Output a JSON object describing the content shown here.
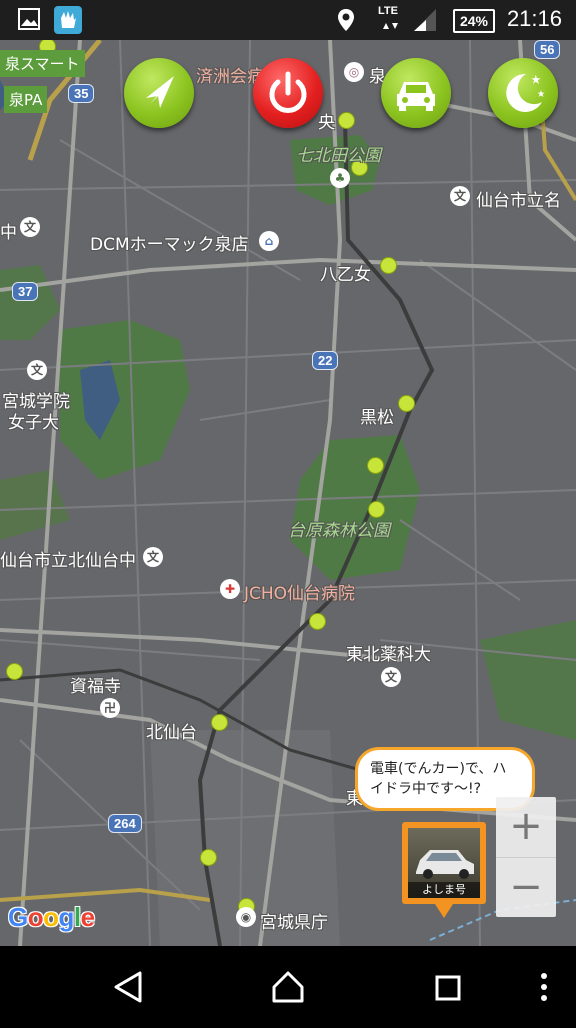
{
  "status_bar": {
    "time": "21:16",
    "battery": "24%",
    "network": "LTE",
    "icons": [
      "image-icon",
      "glove-app-icon",
      "location-pin-icon",
      "signal-icon"
    ]
  },
  "map_labels": {
    "izumi_smart": "泉スマート",
    "izumi_pa": "泉PA",
    "hospital_top": "済洲会病院",
    "izumi_top": "泉",
    "chuo": "央",
    "nanakita_park": "七北田公園",
    "sendai_school_top": "仙台市立名",
    "naka": "中",
    "dcm": "DCMホーマック泉店",
    "yaotome": "八乙女",
    "miyagi_gakuin": "宮城学院",
    "joshidai": "女子大",
    "kuromatsu": "黒松",
    "dainohara_park": "台原森林公園",
    "kitasendai_school": "仙台市立北仙台中",
    "jcho_hospital": "JCHO仙台病院",
    "tohoku_yakka": "東北薬科大",
    "shifukuji": "資福寺",
    "kitasendai": "北仙台",
    "east_char": "東",
    "miyagi_kencho": "宮城県庁"
  },
  "road_numbers": [
    "56",
    "35",
    "37",
    "22",
    "264"
  ],
  "buttons": {
    "navigate": "navigate-arrow-icon",
    "power": "power-icon",
    "car": "car-icon",
    "night": "moon-stars-icon"
  },
  "bubble": {
    "text": "電車(でんカー)で、ハイドラ中です〜!?"
  },
  "car_marker": {
    "caption": "よしま号"
  },
  "zoom": {
    "plus": "+",
    "minus": "−"
  },
  "google_logo": {
    "letters": [
      "G",
      "o",
      "o",
      "g",
      "l",
      "e"
    ],
    "colors": [
      "#4285f4",
      "#ea4335",
      "#fbbc05",
      "#4285f4",
      "#34a853",
      "#ea4335"
    ]
  },
  "colors": {
    "accent_green": "#8cc420",
    "power_red": "#e42020",
    "bubble_border": "#f7a62c",
    "marker_orange": "#f29322",
    "map_bg": "#66676a"
  }
}
